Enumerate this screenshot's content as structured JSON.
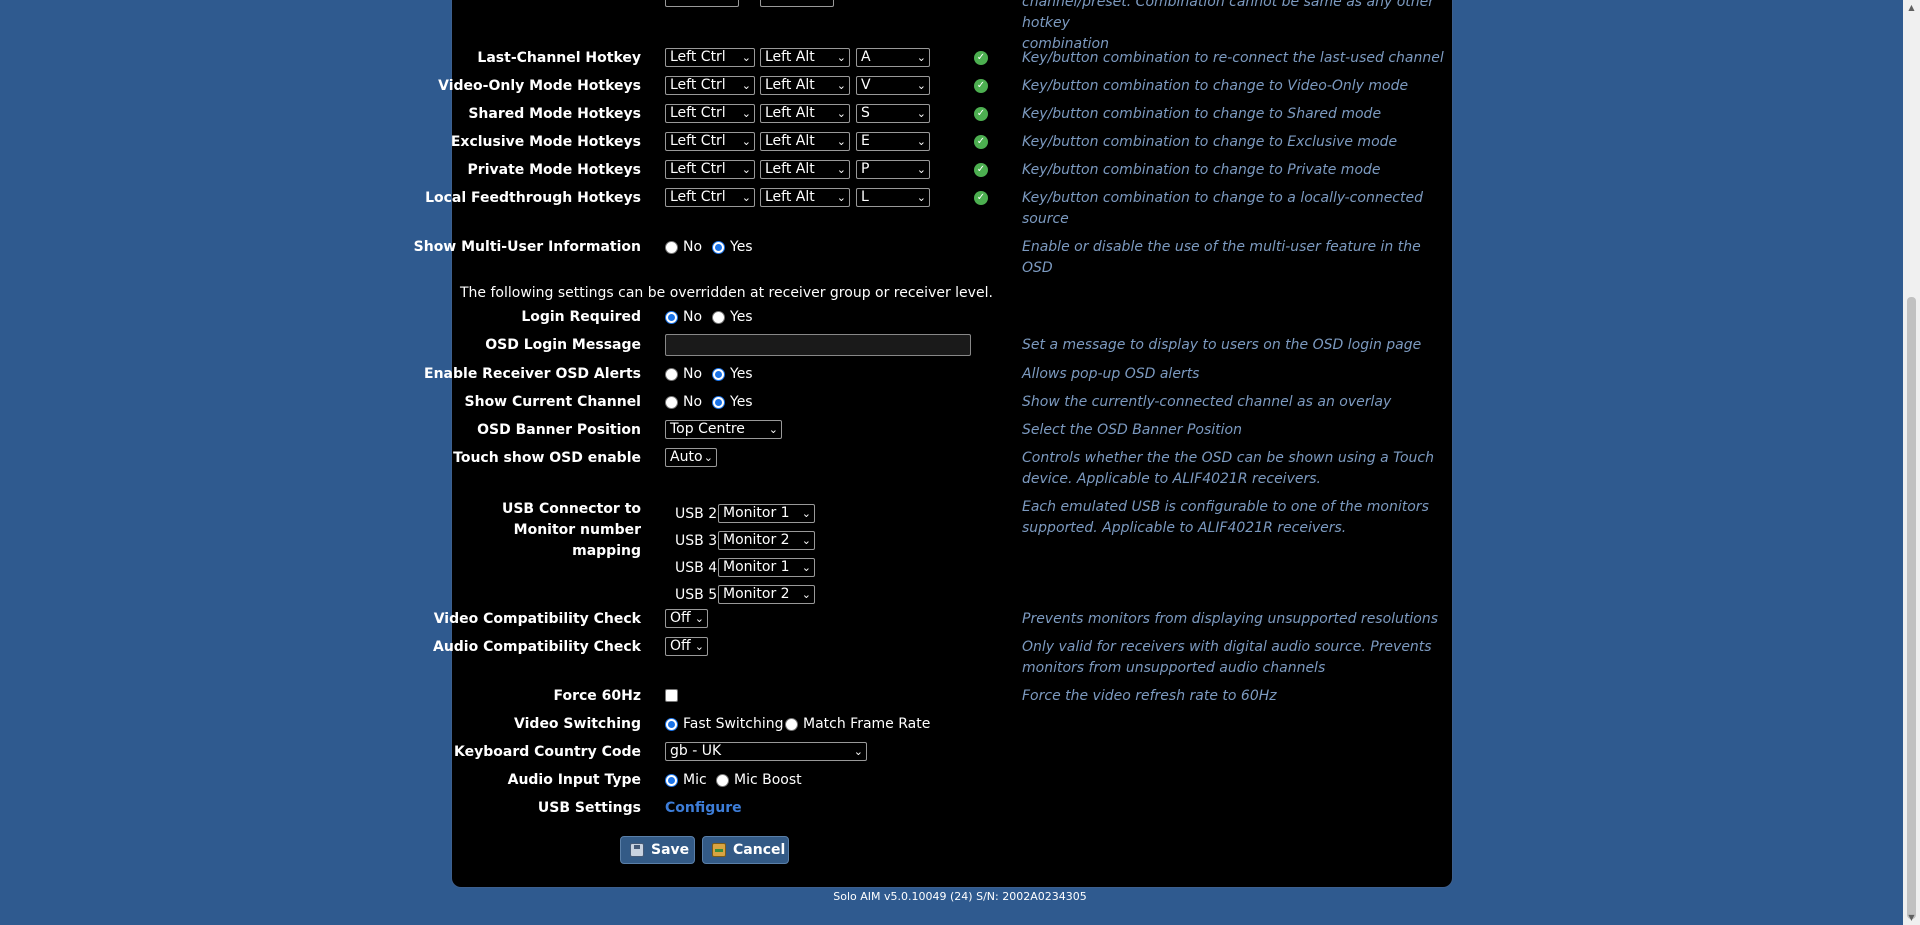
{
  "hotkeys_top_desc": [
    "channel/preset. Combination cannot be same as any other hotkey",
    "combination"
  ],
  "hotkeys": [
    {
      "label": "Last-Channel Hotkey",
      "mod1": "Left Ctrl",
      "mod2": "Left Alt",
      "key": "A",
      "desc": "Key/button combination to re-connect the last-used channel"
    },
    {
      "label": "Video-Only Mode Hotkeys",
      "mod1": "Left Ctrl",
      "mod2": "Left Alt",
      "key": "V",
      "desc": "Key/button combination to change to Video-Only mode"
    },
    {
      "label": "Shared Mode Hotkeys",
      "mod1": "Left Ctrl",
      "mod2": "Left Alt",
      "key": "S",
      "desc": "Key/button combination to change to Shared mode"
    },
    {
      "label": "Exclusive Mode Hotkeys",
      "mod1": "Left Ctrl",
      "mod2": "Left Alt",
      "key": "E",
      "desc": "Key/button combination to change to Exclusive mode"
    },
    {
      "label": "Private Mode Hotkeys",
      "mod1": "Left Ctrl",
      "mod2": "Left Alt",
      "key": "P",
      "desc": "Key/button combination to change to Private mode"
    },
    {
      "label": "Local Feedthrough Hotkeys",
      "mod1": "Left Ctrl",
      "mod2": "Left Alt",
      "key": "L",
      "desc": "Key/button combination to change to a locally-connected source"
    }
  ],
  "multi_user": {
    "label": "Show Multi-User Information",
    "no": "No",
    "yes": "Yes",
    "selected": "Yes",
    "desc": "Enable or disable the use of the multi-user feature in the OSD"
  },
  "override_note": "The following settings can be overridden at receiver group or receiver level.",
  "login_required": {
    "label": "Login Required",
    "no": "No",
    "yes": "Yes",
    "selected": "No"
  },
  "osd_login_message": {
    "label": "OSD Login Message",
    "value": "",
    "desc": "Set a message to display to users on the OSD login page"
  },
  "osd_alerts": {
    "label": "Enable Receiver OSD Alerts",
    "no": "No",
    "yes": "Yes",
    "selected": "Yes",
    "desc": "Allows pop-up OSD alerts"
  },
  "current_channel": {
    "label": "Show Current Channel",
    "no": "No",
    "yes": "Yes",
    "selected": "Yes",
    "desc": "Show the currently-connected channel as an overlay"
  },
  "banner_position": {
    "label": "OSD Banner Position",
    "value": "Top Centre",
    "desc": "Select the OSD Banner Position"
  },
  "touch_osd": {
    "label": "Touch show OSD enable",
    "value": "Auto",
    "desc": "Controls whether the the OSD can be shown using a Touch device. Applicable to ALIF4021R receivers."
  },
  "usb_mapping": {
    "label": "USB Connector to Monitor number mapping",
    "desc": "Each emulated USB is configurable to one of the monitors supported. Applicable to ALIF4021R receivers.",
    "items": [
      {
        "usb": "USB 2",
        "monitor": "Monitor 1"
      },
      {
        "usb": "USB 3",
        "monitor": "Monitor 2"
      },
      {
        "usb": "USB 4",
        "monitor": "Monitor 1"
      },
      {
        "usb": "USB 5",
        "monitor": "Monitor 2"
      }
    ]
  },
  "video_check": {
    "label": "Video Compatibility Check",
    "value": "Off",
    "desc": "Prevents monitors from displaying unsupported resolutions"
  },
  "audio_check": {
    "label": "Audio Compatibility Check",
    "value": "Off",
    "desc": "Only valid for receivers with digital audio source. Prevents monitors from unsupported audio channels"
  },
  "force60": {
    "label": "Force 60Hz",
    "checked": false,
    "desc": "Force the video refresh rate to 60Hz"
  },
  "video_switching": {
    "label": "Video Switching",
    "opt1": "Fast Switching",
    "opt2": "Match Frame Rate",
    "selected": "Fast Switching"
  },
  "keyboard": {
    "label": "Keyboard Country Code",
    "value": "gb - UK"
  },
  "audio_input": {
    "label": "Audio Input Type",
    "opt1": "Mic",
    "opt2": "Mic Boost",
    "selected": "Mic"
  },
  "usb_settings": {
    "label": "USB Settings",
    "link": "Configure"
  },
  "buttons": {
    "save": "Save",
    "cancel": "Cancel"
  },
  "footer": "Solo AIM v5.0.10049 (24)  S/N: 2002A0234305",
  "colors": {
    "bg": "#2f5a8f",
    "panel": "#000000",
    "desc": "#7c9ac0",
    "link": "#3d7dd8",
    "ok": "#4caf50"
  }
}
